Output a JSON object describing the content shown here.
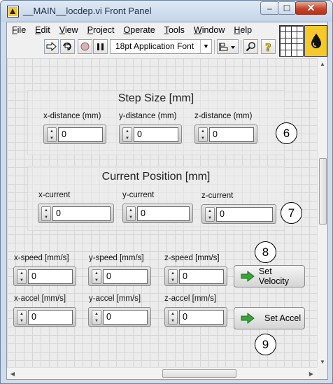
{
  "window": {
    "title": "__MAIN__locdep.vi Front Panel",
    "min_glyph": "–",
    "max_glyph": "☐",
    "close_glyph": "✕"
  },
  "menu": {
    "items": [
      {
        "accel": "F",
        "rest": "ile"
      },
      {
        "accel": "E",
        "rest": "dit"
      },
      {
        "accel": "V",
        "rest": "iew"
      },
      {
        "accel": "P",
        "rest": "roject"
      },
      {
        "accel": "O",
        "rest": "perate"
      },
      {
        "accel": "T",
        "rest": "ools"
      },
      {
        "accel": "W",
        "rest": "indow"
      },
      {
        "accel": "H",
        "rest": "elp"
      }
    ]
  },
  "toolbar": {
    "font": "18pt Application Font",
    "icons": [
      "run-arrow-icon",
      "run-continuously-icon",
      "abort-icon",
      "pause-icon",
      "align-objects-icon",
      "search-icon",
      "context-help-icon"
    ]
  },
  "step_size": {
    "title": "Step Size [mm]",
    "x_label": "x-distance (mm)",
    "x_value": "0",
    "y_label": "y-distance (mm)",
    "y_value": "0",
    "z_label": "z-distance (mm)",
    "z_value": "0",
    "marker": "6"
  },
  "current_position": {
    "title": "Current Position [mm]",
    "x_label": "x-current",
    "x_value": "0",
    "y_label": "y-current",
    "y_value": "0",
    "z_label": "z-current",
    "z_value": "0",
    "marker": "7"
  },
  "velocity": {
    "x_label": "x-speed [mm/s]",
    "x_value": "0",
    "y_label": "y-speed [mm/s]",
    "y_value": "0",
    "z_label": "z-speed [mm/s]",
    "z_value": "0",
    "button": "Set Velocity",
    "marker": "8"
  },
  "acceleration": {
    "x_label": "x-accel [mm/s]",
    "x_value": "0",
    "y_label": "y-accel [mm/s]",
    "y_value": "0",
    "z_label": "z-accel [mm/s]",
    "z_value": "0",
    "button": "Set Accel",
    "marker": "9"
  },
  "colors": {
    "accent_green": "#3aa33a",
    "vi_icon_yellow": "#f5c82b",
    "close_red": "#c7432a"
  }
}
